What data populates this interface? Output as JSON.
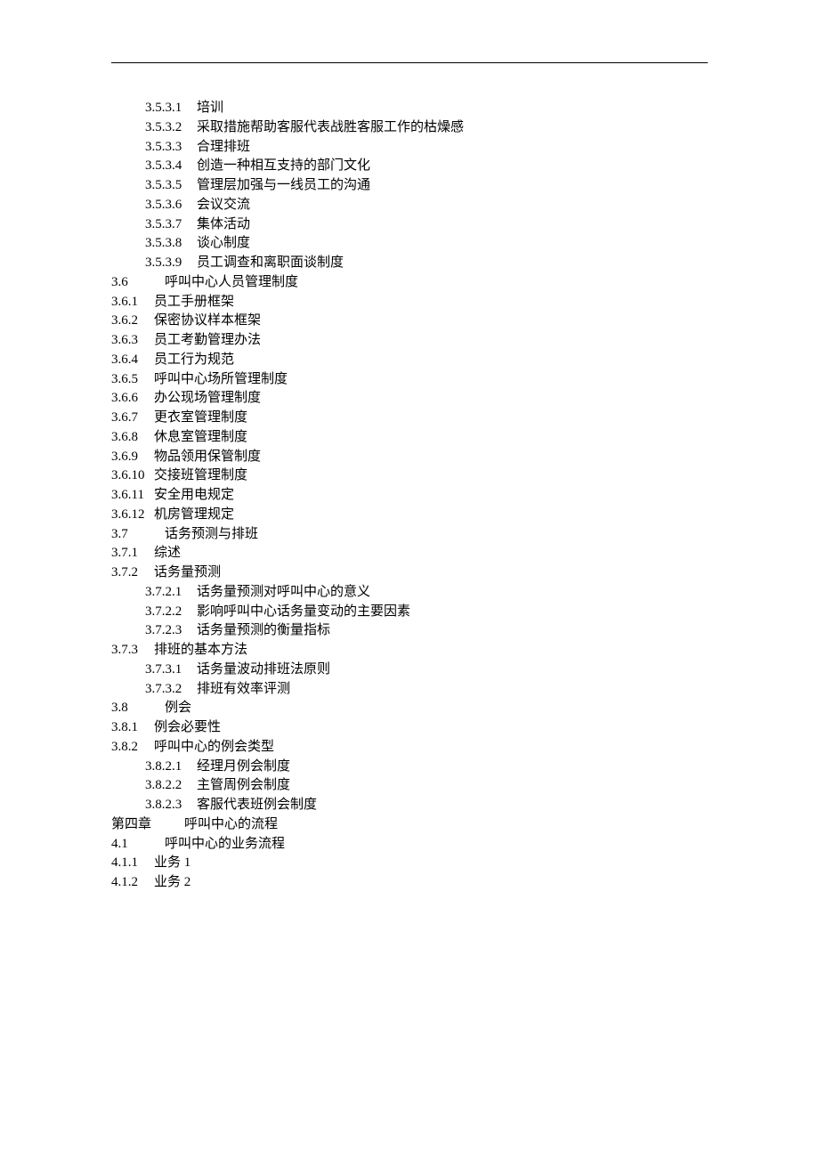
{
  "toc": [
    {
      "indent": 1,
      "num": "3.5.3.1",
      "numClass": "num-leaf",
      "title": "培训"
    },
    {
      "indent": 1,
      "num": "3.5.3.2",
      "numClass": "num-leaf",
      "title": "采取措施帮助客服代表战胜客服工作的枯燥感"
    },
    {
      "indent": 1,
      "num": "3.5.3.3",
      "numClass": "num-leaf",
      "title": "合理排班"
    },
    {
      "indent": 1,
      "num": "3.5.3.4",
      "numClass": "num-leaf",
      "title": "创造一种相互支持的部门文化"
    },
    {
      "indent": 1,
      "num": "3.5.3.5",
      "numClass": "num-leaf",
      "title": "管理层加强与一线员工的沟通"
    },
    {
      "indent": 1,
      "num": "3.5.3.6",
      "numClass": "num-leaf",
      "title": "会议交流"
    },
    {
      "indent": 1,
      "num": "3.5.3.7",
      "numClass": "num-leaf",
      "title": "集体活动"
    },
    {
      "indent": 1,
      "num": "3.5.3.8",
      "numClass": "num-leaf",
      "title": "谈心制度"
    },
    {
      "indent": 1,
      "num": "3.5.3.9",
      "numClass": "num-leaf",
      "title": "员工调查和离职面谈制度"
    },
    {
      "indent": 0,
      "num": "3.6",
      "numClass": "num-sec",
      "title": "呼叫中心人员管理制度"
    },
    {
      "indent": 0,
      "num": "3.6.1",
      "numClass": "num-sub",
      "title": "员工手册框架"
    },
    {
      "indent": 0,
      "num": "3.6.2",
      "numClass": "num-sub",
      "title": "保密协议样本框架"
    },
    {
      "indent": 0,
      "num": "3.6.3",
      "numClass": "num-sub",
      "title": "员工考勤管理办法"
    },
    {
      "indent": 0,
      "num": "3.6.4",
      "numClass": "num-sub",
      "title": "员工行为规范"
    },
    {
      "indent": 0,
      "num": "3.6.5",
      "numClass": "num-sub",
      "title": "呼叫中心场所管理制度"
    },
    {
      "indent": 0,
      "num": "3.6.6",
      "numClass": "num-sub",
      "title": "办公现场管理制度"
    },
    {
      "indent": 0,
      "num": "3.6.7",
      "numClass": "num-sub",
      "title": "更衣室管理制度"
    },
    {
      "indent": 0,
      "num": "3.6.8",
      "numClass": "num-sub",
      "title": "休息室管理制度"
    },
    {
      "indent": 0,
      "num": "3.6.9",
      "numClass": "num-sub",
      "title": "物品领用保管制度"
    },
    {
      "indent": 0,
      "num": "3.6.10",
      "numClass": "num-sub",
      "title": "交接班管理制度"
    },
    {
      "indent": 0,
      "num": "3.6.11",
      "numClass": "num-sub",
      "title": "安全用电规定"
    },
    {
      "indent": 0,
      "num": "3.6.12",
      "numClass": "num-sub",
      "title": "机房管理规定"
    },
    {
      "indent": 0,
      "num": "3.7",
      "numClass": "num-sec",
      "title": "话务预测与排班"
    },
    {
      "indent": 0,
      "num": "3.7.1",
      "numClass": "num-sub",
      "title": "综述"
    },
    {
      "indent": 0,
      "num": "3.7.2",
      "numClass": "num-sub",
      "title": "话务量预测"
    },
    {
      "indent": 1,
      "num": "3.7.2.1",
      "numClass": "num-leaf",
      "title": "话务量预测对呼叫中心的意义"
    },
    {
      "indent": 1,
      "num": "3.7.2.2",
      "numClass": "num-leaf",
      "title": "影响呼叫中心话务量变动的主要因素"
    },
    {
      "indent": 1,
      "num": "3.7.2.3",
      "numClass": "num-leaf",
      "title": "话务量预测的衡量指标"
    },
    {
      "indent": 0,
      "num": "3.7.3",
      "numClass": "num-sub",
      "title": "排班的基本方法"
    },
    {
      "indent": 1,
      "num": "3.7.3.1",
      "numClass": "num-leaf",
      "title": "话务量波动排班法原则"
    },
    {
      "indent": 1,
      "num": "3.7.3.2",
      "numClass": "num-leaf",
      "title": "排班有效率评测"
    },
    {
      "indent": 0,
      "num": "3.8",
      "numClass": "num-sec",
      "title": "例会"
    },
    {
      "indent": 0,
      "num": "3.8.1",
      "numClass": "num-sub",
      "title": "例会必要性"
    },
    {
      "indent": 0,
      "num": "3.8.2",
      "numClass": "num-sub",
      "title": "呼叫中心的例会类型"
    },
    {
      "indent": 1,
      "num": "3.8.2.1",
      "numClass": "num-leaf",
      "title": "经理月例会制度"
    },
    {
      "indent": 1,
      "num": "3.8.2.2",
      "numClass": "num-leaf",
      "title": "主管周例会制度"
    },
    {
      "indent": 1,
      "num": "3.8.2.3",
      "numClass": "num-leaf",
      "title": "客服代表班例会制度"
    },
    {
      "indent": 0,
      "num": "第四章",
      "numClass": "num-chapter",
      "title": "呼叫中心的流程",
      "chapterGap": true
    },
    {
      "indent": 0,
      "num": "4.1",
      "numClass": "num-sec",
      "title": "呼叫中心的业务流程"
    },
    {
      "indent": 0,
      "num": "4.1.1",
      "numClass": "num-sub",
      "title": "业务 1"
    },
    {
      "indent": 0,
      "num": "4.1.2",
      "numClass": "num-sub",
      "title": "业务 2"
    }
  ]
}
